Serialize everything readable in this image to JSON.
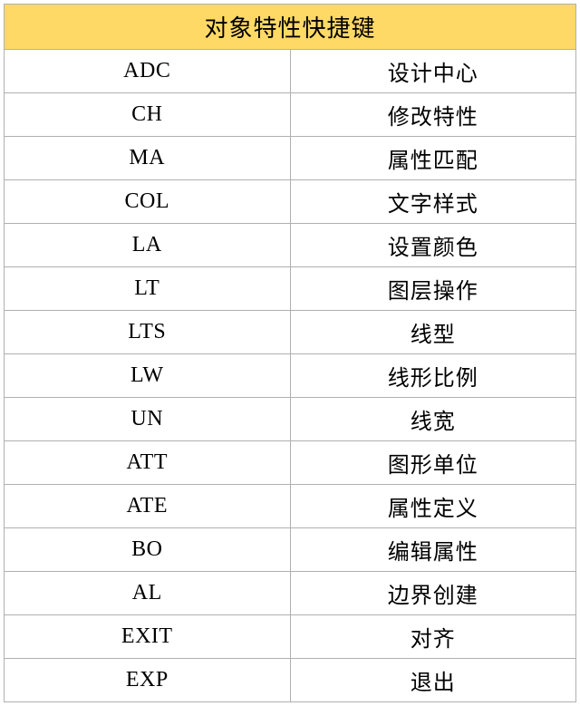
{
  "title": "对象特性快捷键",
  "rows": [
    {
      "shortcut": "ADC",
      "desc": "设计中心"
    },
    {
      "shortcut": "CH",
      "desc": "修改特性"
    },
    {
      "shortcut": "MA",
      "desc": "属性匹配"
    },
    {
      "shortcut": "COL",
      "desc": "文字样式"
    },
    {
      "shortcut": "LA",
      "desc": "设置颜色"
    },
    {
      "shortcut": "LT",
      "desc": "图层操作"
    },
    {
      "shortcut": "LTS",
      "desc": "线型"
    },
    {
      "shortcut": "LW",
      "desc": "线形比例"
    },
    {
      "shortcut": "UN",
      "desc": "线宽"
    },
    {
      "shortcut": "ATT",
      "desc": "图形单位"
    },
    {
      "shortcut": "ATE",
      "desc": "属性定义"
    },
    {
      "shortcut": "BO",
      "desc": "编辑属性"
    },
    {
      "shortcut": "AL",
      "desc": "边界创建"
    },
    {
      "shortcut": "EXIT",
      "desc": "对齐"
    },
    {
      "shortcut": "EXP",
      "desc": "退出"
    }
  ]
}
